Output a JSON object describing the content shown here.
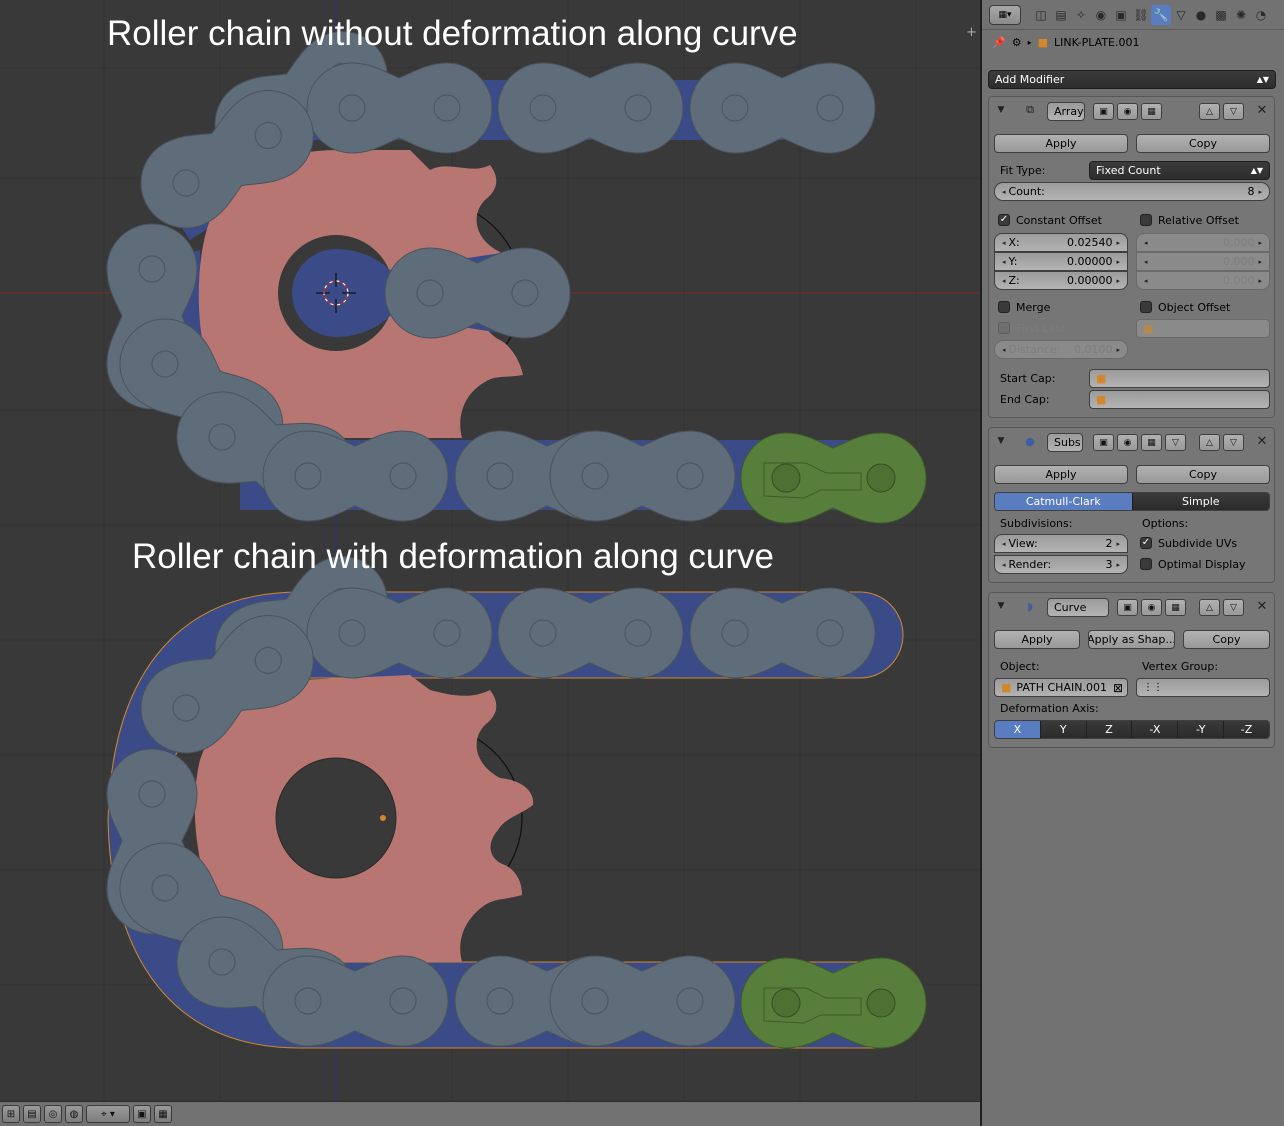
{
  "viewport": {
    "title_top": "Roller chain without deformation along curve",
    "title_bottom": "Roller chain with deformation along curve"
  },
  "footer": {
    "icons": [
      "view-menu-icon",
      "object-mode-icon",
      "shading-icon",
      "pivot-icon",
      "manipulator-icon",
      "layer-icon",
      "render-icon"
    ]
  },
  "properties": {
    "breadcrumb_object": "LINK-PLATE.001",
    "add_modifier": "Add Modifier",
    "array": {
      "name": "Array",
      "apply": "Apply",
      "copy": "Copy",
      "fit_type_label": "Fit Type:",
      "fit_type_value": "Fixed Count",
      "count_label": "Count:",
      "count_value": "8",
      "constant_offset": "Constant Offset",
      "constant_offset_checked": true,
      "relative_offset": "Relative Offset",
      "relative_offset_checked": false,
      "x_label": "X:",
      "x_value": "0.02540",
      "y_label": "Y:",
      "y_value": "0.00000",
      "z_label": "Z:",
      "z_value": "0.00000",
      "rel_x": "0.000",
      "rel_y": "0.000",
      "rel_z": "0.000",
      "merge": "Merge",
      "merge_checked": false,
      "first_last": "First Last",
      "object_offset": "Object Offset",
      "object_offset_checked": false,
      "distance_label": "Distance:",
      "distance_value": "0.0100",
      "start_cap": "Start Cap:",
      "end_cap": "End Cap:"
    },
    "subsurf": {
      "name": "Subs",
      "apply": "Apply",
      "copy": "Copy",
      "mode_catmull": "Catmull-Clark",
      "mode_simple": "Simple",
      "subdivisions_label": "Subdivisions:",
      "options_label": "Options:",
      "view_label": "View:",
      "view_value": "2",
      "render_label": "Render:",
      "render_value": "3",
      "subdivide_uvs": "Subdivide UVs",
      "subdivide_uvs_checked": true,
      "optimal_display": "Optimal Display",
      "optimal_display_checked": false
    },
    "curve": {
      "name": "Curve",
      "apply": "Apply",
      "apply_shape": "Apply as Shap...",
      "copy": "Copy",
      "object_label": "Object:",
      "object_value": "PATH CHAIN.001",
      "vertex_group_label": "Vertex Group:",
      "deformation_axis_label": "Deformation Axis:",
      "axes": [
        "X",
        "Y",
        "Z",
        "-X",
        "-Y",
        "-Z"
      ],
      "active_axis": "X"
    }
  },
  "colors": {
    "link_plate": "#5f6c79",
    "chain_blue": "#3b4b88",
    "sprocket": "#b87672",
    "active_link": "#577f3b",
    "accent": "#5a7cc0"
  }
}
